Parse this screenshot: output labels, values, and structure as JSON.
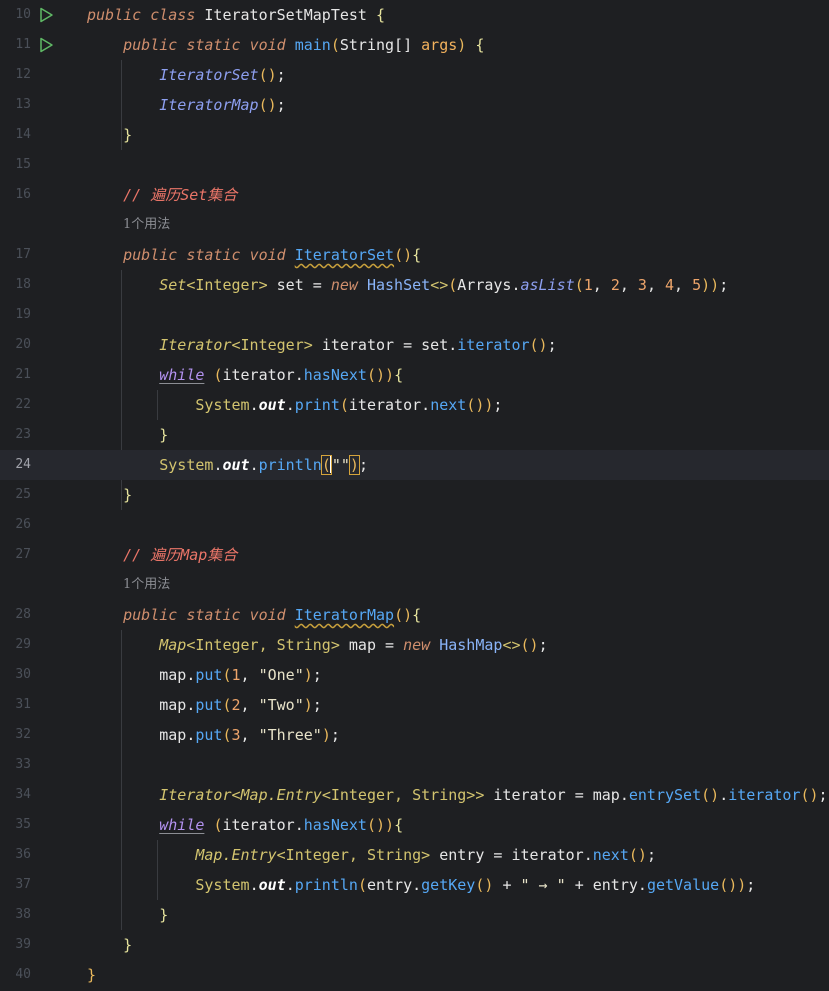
{
  "editor": {
    "current_line": "24",
    "lines": [
      {
        "n": "10",
        "run": true
      },
      {
        "n": "11",
        "run": true
      },
      {
        "n": "12"
      },
      {
        "n": "13"
      },
      {
        "n": "14"
      },
      {
        "n": "15"
      },
      {
        "n": "16"
      },
      {
        "n": "17"
      },
      {
        "n": "18"
      },
      {
        "n": "19"
      },
      {
        "n": "20"
      },
      {
        "n": "21"
      },
      {
        "n": "22"
      },
      {
        "n": "23"
      },
      {
        "n": "24"
      },
      {
        "n": "25"
      },
      {
        "n": "26"
      },
      {
        "n": "27"
      },
      {
        "n": "28"
      },
      {
        "n": "29"
      },
      {
        "n": "30"
      },
      {
        "n": "31"
      },
      {
        "n": "32"
      },
      {
        "n": "33"
      },
      {
        "n": "34"
      },
      {
        "n": "35"
      },
      {
        "n": "36"
      },
      {
        "n": "37"
      },
      {
        "n": "38"
      },
      {
        "n": "39"
      },
      {
        "n": "40"
      }
    ],
    "usage_hint_1": "1个用法",
    "usage_hint_2": "1个用法",
    "comment_set": "// 遍历Set集合",
    "comment_map": "// 遍历Map集合"
  },
  "colors": {
    "background": "#1e1f22",
    "current_line": "#26282e",
    "keyword": "#cf8e6d",
    "method": "#56a8f5",
    "string": "#6aab73",
    "number": "#eea56b",
    "comment": "#ea7568"
  },
  "icons": {
    "run": "run-triangle-icon"
  }
}
